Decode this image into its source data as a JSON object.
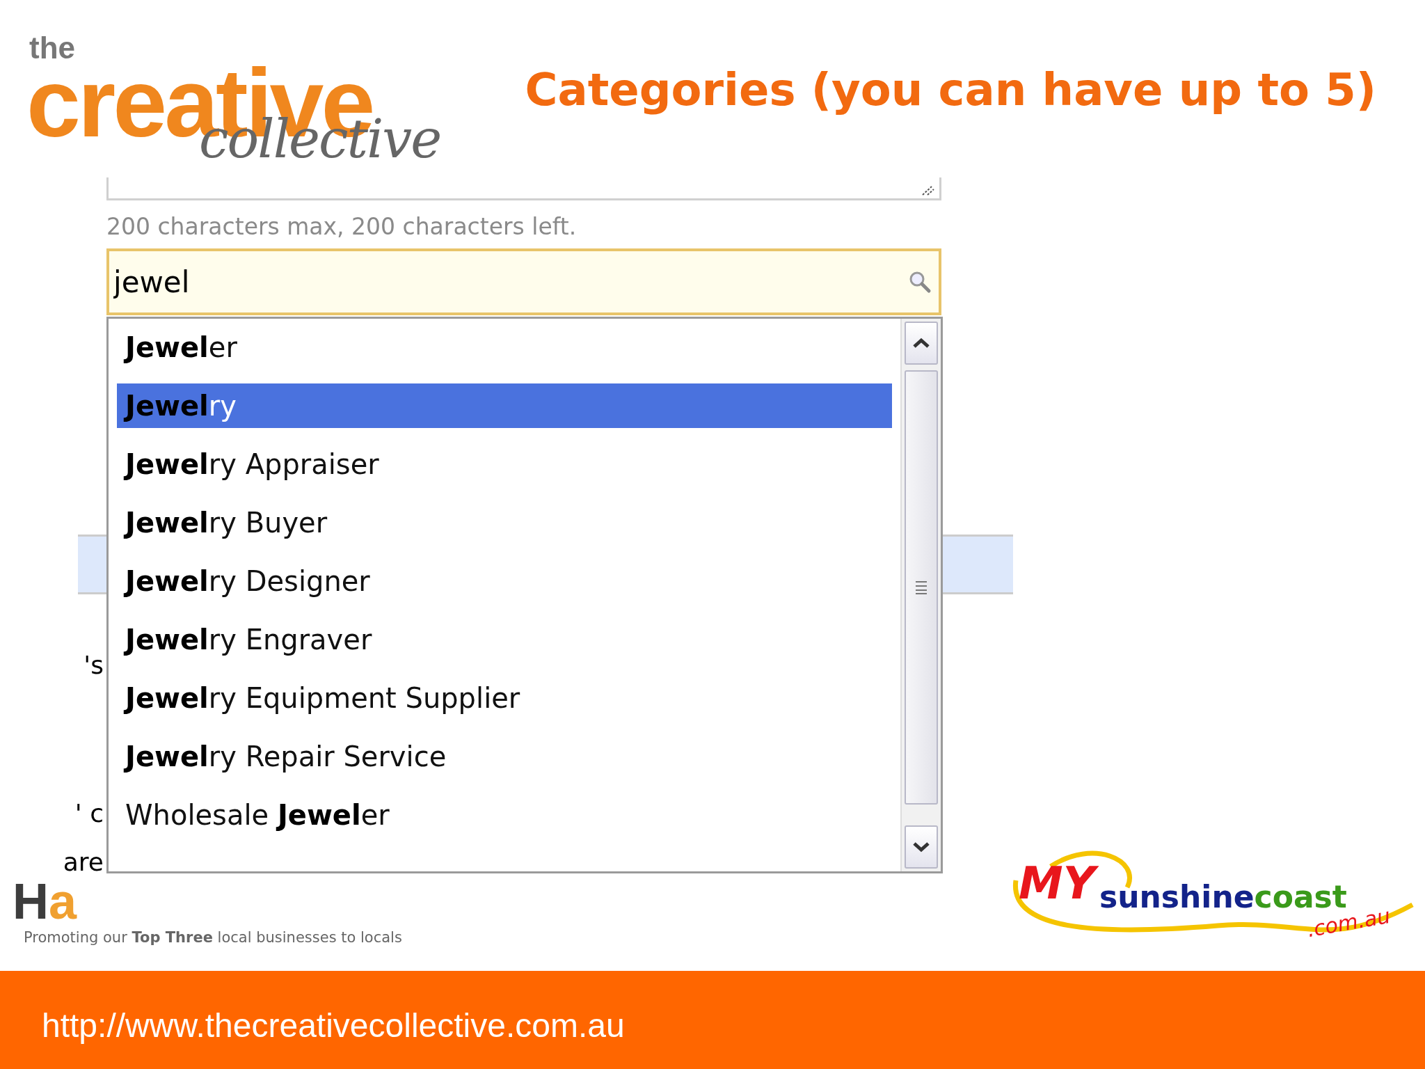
{
  "logo": {
    "the": "the",
    "creative": "creative",
    "collective": "collective"
  },
  "title": "Categories (you can have up to 5)",
  "description_field": {
    "hint": "200 characters max, 200 characters left."
  },
  "search_field": {
    "value": "jewel"
  },
  "suggestions": [
    {
      "label": "**Jewel**er",
      "selected": false
    },
    {
      "label": "**Jewel**ry",
      "selected": true
    },
    {
      "label": "**Jewel**ry Appraiser",
      "selected": false
    },
    {
      "label": "**Jewel**ry Buyer",
      "selected": false
    },
    {
      "label": "**Jewel**ry Designer",
      "selected": false
    },
    {
      "label": "**Jewel**ry Engraver",
      "selected": false
    },
    {
      "label": "**Jewel**ry Equipment Supplier",
      "selected": false
    },
    {
      "label": "**Jewel**ry Repair Service",
      "selected": false
    },
    {
      "label": "Wholesale **Jewel**er",
      "selected": false
    }
  ],
  "background_fragments": [
    "'s",
    "' c",
    "are"
  ],
  "partner_logo_left": {
    "mark": "Ha",
    "tagline": "Promoting our **Top Three** local businesses to locals"
  },
  "partner_logo_right": {
    "my": "MY",
    "sunshine": "sunshine",
    "coast": "coast",
    "domain": ".com.au"
  },
  "footer": {
    "url": "http://www.thecreativecollective.com.au"
  }
}
